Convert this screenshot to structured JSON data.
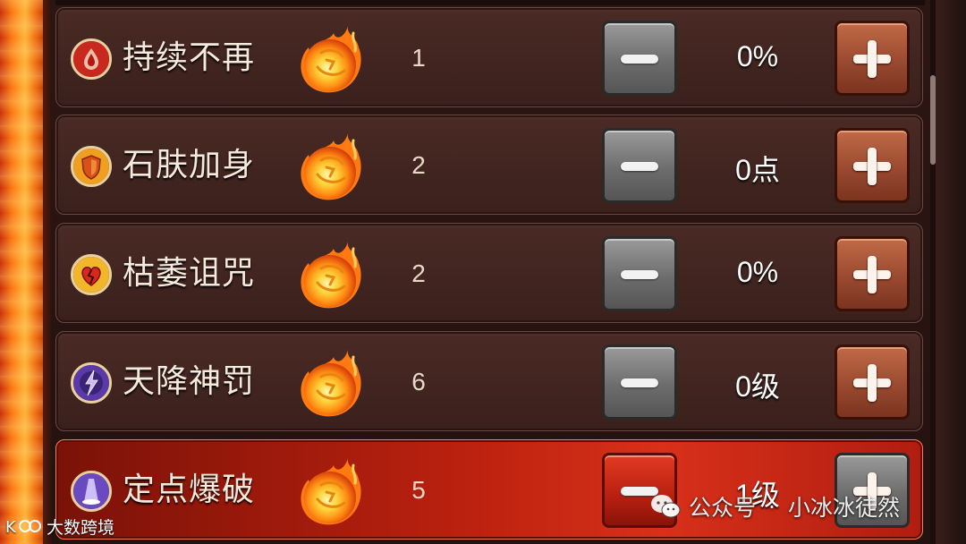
{
  "skills": [
    {
      "name": "持续不再",
      "count": "1",
      "value": "0%",
      "icon": "blood-drop-shield-icon",
      "icon_color": "#c8281e",
      "selected": false
    },
    {
      "name": "石肤加身",
      "count": "2",
      "value": "0点",
      "icon": "shield-icon",
      "icon_color": "#f0a020",
      "selected": false
    },
    {
      "name": "枯萎诅咒",
      "count": "2",
      "value": "0%",
      "icon": "broken-heart-icon",
      "icon_color": "#f2b62a",
      "selected": false
    },
    {
      "name": "天降神罚",
      "count": "6",
      "value": "0级",
      "icon": "lightning-icon",
      "icon_color": "#5a3aa8",
      "selected": false
    },
    {
      "name": "定点爆破",
      "count": "5",
      "value": "1级",
      "icon": "beam-icon",
      "icon_color": "#6a4ac0",
      "selected": true
    }
  ],
  "fire_icon": "fire-orb-icon",
  "watermark_left": {
    "text": "大数跨境"
  },
  "watermark_right": {
    "source": "公众号",
    "separator": "·",
    "author": "小冰冰徒然"
  },
  "colors": {
    "row_bg": "#3a201c",
    "selected_row_bg": "#c8281a",
    "minus_gray": "#7a7a7a",
    "plus_brown": "#9a4a30",
    "value_text": "#ffffff"
  }
}
